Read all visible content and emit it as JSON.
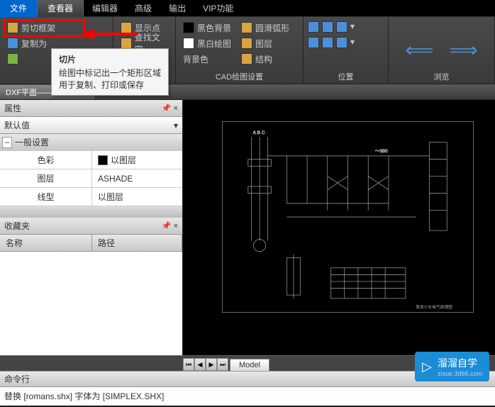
{
  "menu": {
    "file": "文件",
    "viewer": "查看器",
    "editor": "编辑器",
    "advanced": "高级",
    "output": "输出",
    "vip": "VIP功能"
  },
  "ribbon": {
    "crop_frame": "剪切框架",
    "copy_pic": "复制为",
    "show_point": "显示点",
    "find_text": "查找文字",
    "black_bg": "黑色背景",
    "bw_draw": "黑白绘图",
    "bg_color": "背景色",
    "smooth_arc": "圆滑弧形",
    "layer": "图层",
    "structure": "结构",
    "cad_settings_label": "CAD绘图设置",
    "position_label": "位置",
    "browse_label": "浏览"
  },
  "tooltip": {
    "title": "切片",
    "line1": "绘图中标记出一个矩形区域",
    "line2": "用于复制、打印或保存"
  },
  "file_tab": "DXF平面——2004.dxf",
  "props": {
    "header": "属性",
    "default": "默认值",
    "general": "一般设置",
    "color_key": "色彩",
    "color_val": "以图层",
    "layer_key": "图层",
    "layer_val": "ASHADE",
    "linetype_key": "线型",
    "linetype_val": "以图层"
  },
  "favorites": {
    "header": "收藏夹",
    "col_name": "名称",
    "col_path": "路径"
  },
  "model_tab": "Model",
  "cmd": {
    "header": "命令行",
    "text": "替换 [romans.shx] 字体为 [SIMPLEX.SHX]"
  },
  "drawing_labels": {
    "abc": "A   B   C",
    "v380": "～380",
    "caption": "泵类小车电气原理图"
  },
  "watermark": {
    "brand": "溜溜自学",
    "url": "zixue.3d66.com"
  }
}
